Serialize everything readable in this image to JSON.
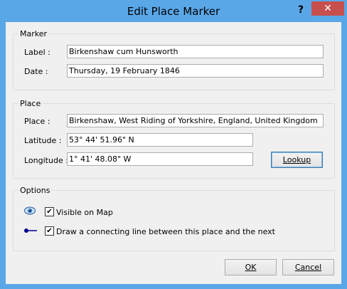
{
  "window": {
    "title": "Edit Place Marker",
    "help_glyph": "?",
    "close_glyph": "✕"
  },
  "marker": {
    "legend": "Marker",
    "label_caption": "Label :",
    "label_value": "Birkenshaw cum Hunsworth",
    "date_caption": "Date :",
    "date_value": "Thursday, 19 February 1846"
  },
  "place": {
    "legend": "Place",
    "place_caption": "Place  :",
    "place_value": "Birkenshaw, West Riding of Yorkshire, England, United Kingdom",
    "latitude_caption": "Latitude :",
    "latitude_value": "53° 44' 51.96\" N",
    "longitude_caption": "Longitude :",
    "longitude_value": "1° 41' 48.08\" W",
    "lookup_label": "Lookup"
  },
  "options": {
    "legend": "Options",
    "visible_label": "Visible on Map",
    "visible_checked": true,
    "line_label": "Draw a connecting line between this place and the next",
    "line_checked": true,
    "icons": [
      "eye-icon",
      "connecting-line-icon"
    ],
    "check_glyph": "✔"
  },
  "footer": {
    "ok_label": "OK",
    "cancel_label": "Cancel"
  },
  "colors": {
    "title_bar": "#5aa7e8",
    "close_button": "#c7504d",
    "dialog_background": "#f0f0f0",
    "line_icon": "#00008b"
  }
}
